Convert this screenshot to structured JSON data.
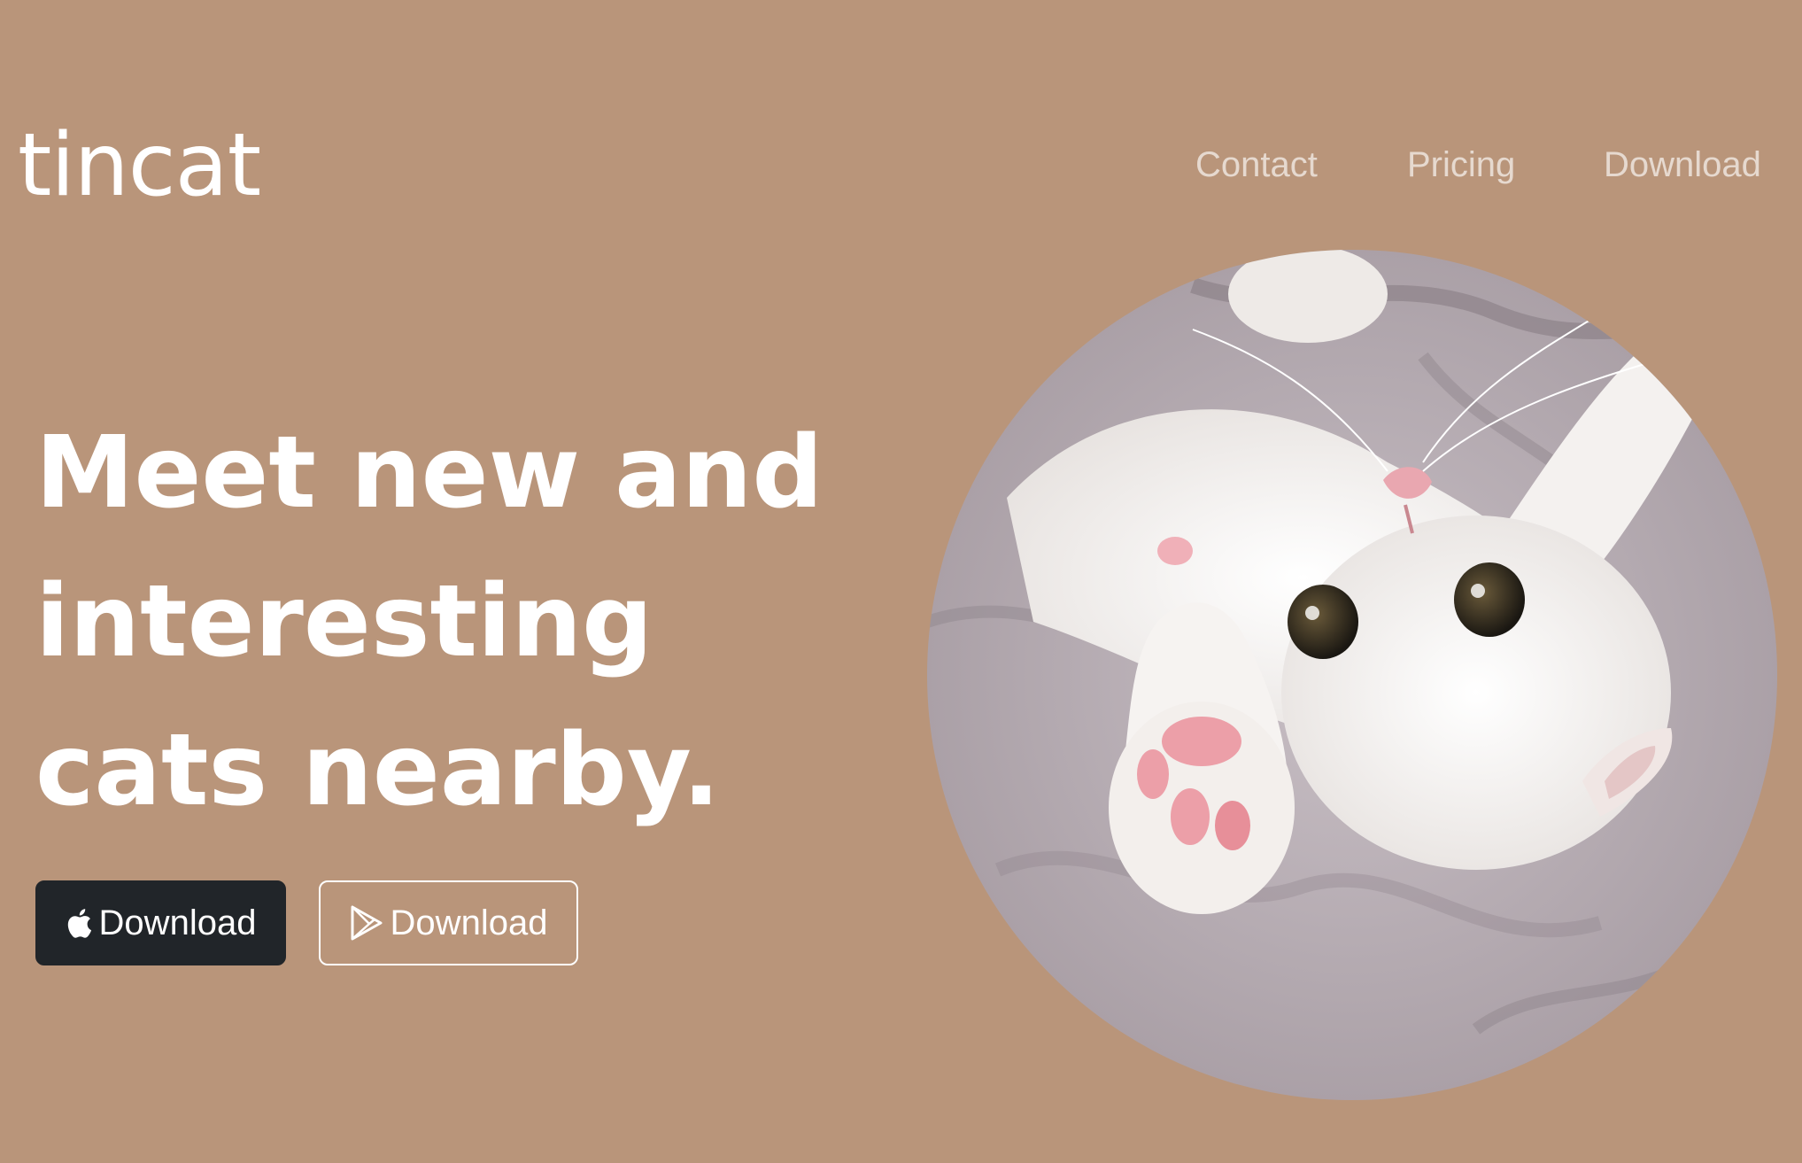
{
  "brand": {
    "name": "tincat"
  },
  "nav": {
    "items": [
      {
        "label": "Contact"
      },
      {
        "label": "Pricing"
      },
      {
        "label": "Download"
      }
    ]
  },
  "hero": {
    "title_lines": [
      "Meet new and",
      "interesting",
      "cats nearby."
    ],
    "buttons": {
      "apple": {
        "label": "Download",
        "icon": "apple-icon"
      },
      "play": {
        "label": "Download",
        "icon": "google-play-icon"
      }
    }
  },
  "image": {
    "subject": "cat-photo"
  },
  "colors": {
    "background": "#b9957a",
    "nav_link": "#e6d9cf",
    "dark_button": "#212529",
    "white": "#ffffff"
  }
}
